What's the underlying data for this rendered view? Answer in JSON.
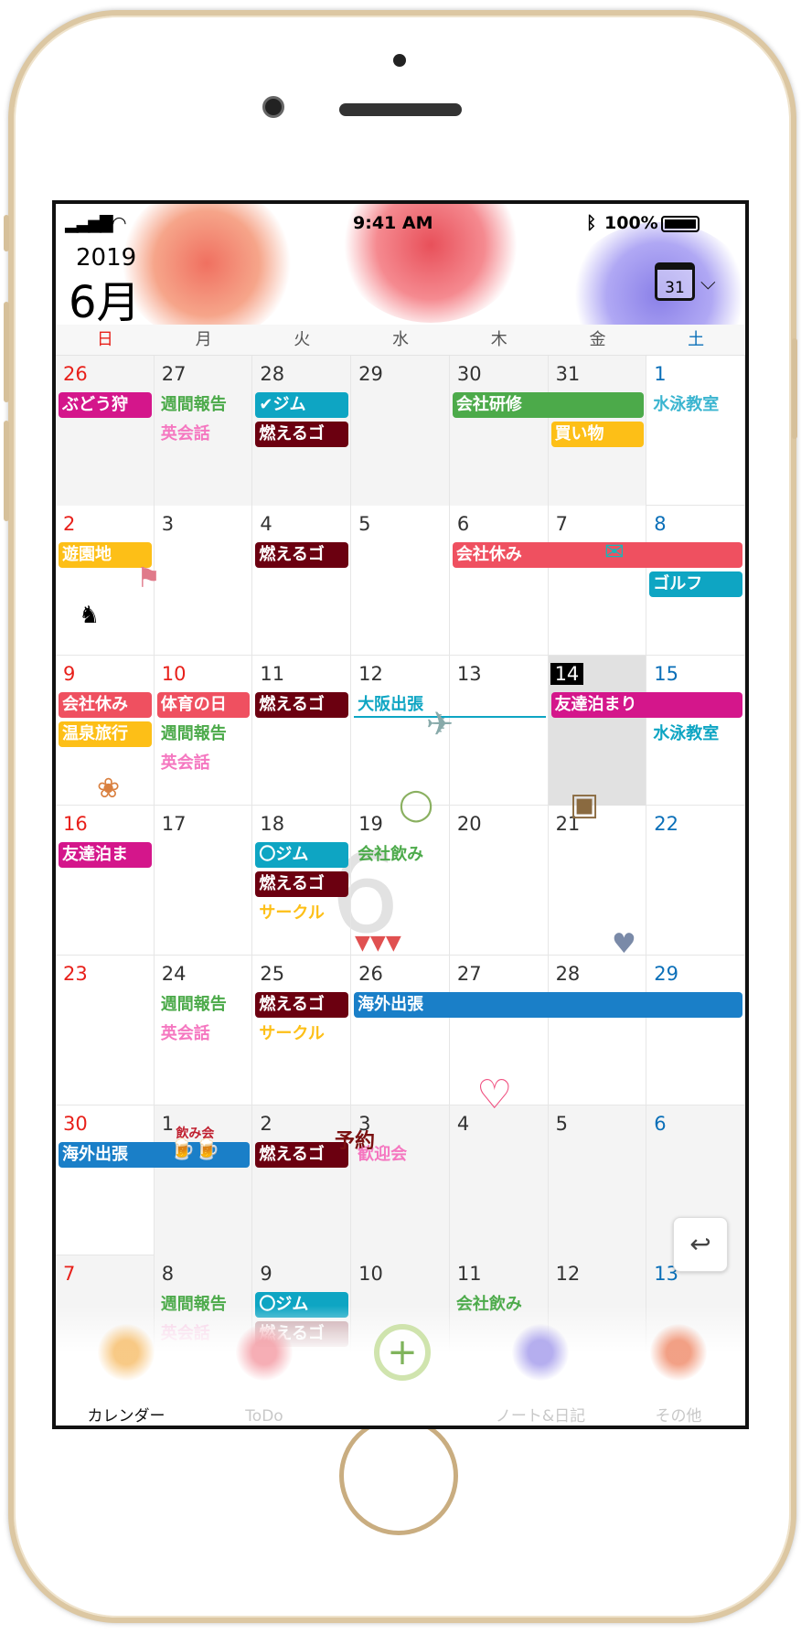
{
  "status": {
    "time": "9:41 AM",
    "battery": "100%",
    "signal_icon": "signal-icon",
    "wifi_icon": "wifi-icon",
    "bluetooth_icon": "bluetooth-icon"
  },
  "header": {
    "year": "2019",
    "month": "6月",
    "calendar_button": "31",
    "chevron": "⌵"
  },
  "weekdays": [
    "日",
    "月",
    "火",
    "水",
    "木",
    "金",
    "土"
  ],
  "watermark": "6",
  "colors": {
    "magenta": "#d4168b",
    "green": "#4caa4a",
    "pink": "#f577c0",
    "teal": "#0ea5c3",
    "maroon": "#6b0010",
    "yellow": "#fdbf17",
    "red": "#ef5060",
    "blue": "#1a7fc8",
    "sky": "#3bb5d0"
  },
  "weeks": [
    {
      "days": [
        {
          "d": "26",
          "other": true
        },
        {
          "d": "27",
          "other": true
        },
        {
          "d": "28",
          "other": true
        },
        {
          "d": "29",
          "other": true
        },
        {
          "d": "30",
          "other": true
        },
        {
          "d": "31",
          "other": true
        },
        {
          "d": "1"
        }
      ],
      "events": [
        {
          "text": "ぶどう狩",
          "col": 0,
          "span": 1,
          "lane": 0,
          "style": "bar",
          "color": "magenta"
        },
        {
          "text": "週間報告",
          "col": 1,
          "span": 1,
          "lane": 0,
          "style": "text",
          "color": "green"
        },
        {
          "text": "英会話",
          "col": 1,
          "span": 1,
          "lane": 1,
          "style": "text",
          "color": "pink"
        },
        {
          "text": "✔ジム",
          "col": 2,
          "span": 1,
          "lane": 0,
          "style": "bar",
          "color": "teal"
        },
        {
          "text": "燃えるゴ",
          "col": 2,
          "span": 1,
          "lane": 1,
          "style": "bar",
          "color": "maroon"
        },
        {
          "text": "会社研修",
          "col": 4,
          "span": 2,
          "lane": 0,
          "style": "bar",
          "color": "green"
        },
        {
          "text": "買い物",
          "col": 5,
          "span": 1,
          "lane": 1,
          "style": "bar",
          "color": "yellow"
        },
        {
          "text": "水泳教室",
          "col": 6,
          "span": 1,
          "lane": 0,
          "style": "text",
          "color": "sky"
        }
      ]
    },
    {
      "days": [
        {
          "d": "2"
        },
        {
          "d": "3"
        },
        {
          "d": "4"
        },
        {
          "d": "5"
        },
        {
          "d": "6"
        },
        {
          "d": "7"
        },
        {
          "d": "8"
        }
      ],
      "events": [
        {
          "text": "遊園地",
          "col": 0,
          "span": 1,
          "lane": 0,
          "style": "bar",
          "color": "yellow"
        },
        {
          "text": "燃えるゴ",
          "col": 2,
          "span": 1,
          "lane": 0,
          "style": "bar",
          "color": "maroon"
        },
        {
          "text": "会社休み",
          "col": 4,
          "span": 3,
          "lane": 0,
          "style": "bar",
          "color": "red"
        },
        {
          "text": "ゴルフ",
          "col": 6,
          "span": 1,
          "lane": 1,
          "style": "bar",
          "color": "teal"
        }
      ]
    },
    {
      "days": [
        {
          "d": "9"
        },
        {
          "d": "10",
          "holiday": true
        },
        {
          "d": "11"
        },
        {
          "d": "12"
        },
        {
          "d": "13"
        },
        {
          "d": "14",
          "today": true
        },
        {
          "d": "15"
        }
      ],
      "events": [
        {
          "text": "会社休み",
          "col": 0,
          "span": 1,
          "lane": 0,
          "style": "bar",
          "color": "red"
        },
        {
          "text": "温泉旅行",
          "col": 0,
          "span": 1,
          "lane": 1,
          "style": "bar",
          "color": "yellow"
        },
        {
          "text": "体育の日",
          "col": 1,
          "span": 1,
          "lane": 0,
          "style": "bar",
          "color": "red"
        },
        {
          "text": "週間報告",
          "col": 1,
          "span": 1,
          "lane": 1,
          "style": "text",
          "color": "green"
        },
        {
          "text": "英会話",
          "col": 1,
          "span": 1,
          "lane": 2,
          "style": "text",
          "color": "pink"
        },
        {
          "text": "燃えるゴ",
          "col": 2,
          "span": 1,
          "lane": 0,
          "style": "bar",
          "color": "maroon"
        },
        {
          "text": "大阪出張",
          "col": 3,
          "span": 2,
          "lane": 0,
          "style": "line",
          "color": "teal"
        },
        {
          "text": "友達泊まり",
          "col": 5,
          "span": 2,
          "lane": 0,
          "style": "bar",
          "color": "magenta"
        },
        {
          "text": "水泳教室",
          "col": 6,
          "span": 1,
          "lane": 1,
          "style": "text",
          "color": "teal"
        }
      ]
    },
    {
      "days": [
        {
          "d": "16"
        },
        {
          "d": "17"
        },
        {
          "d": "18"
        },
        {
          "d": "19"
        },
        {
          "d": "20"
        },
        {
          "d": "21"
        },
        {
          "d": "22"
        }
      ],
      "events": [
        {
          "text": "友達泊ま",
          "col": 0,
          "span": 1,
          "lane": 0,
          "style": "bar",
          "color": "magenta"
        },
        {
          "text": "〇ジム",
          "col": 2,
          "span": 1,
          "lane": 0,
          "style": "bar",
          "color": "teal"
        },
        {
          "text": "燃えるゴ",
          "col": 2,
          "span": 1,
          "lane": 1,
          "style": "bar",
          "color": "maroon"
        },
        {
          "text": "サークル",
          "col": 2,
          "span": 1,
          "lane": 2,
          "style": "text",
          "color": "yellow"
        },
        {
          "text": "会社飲み",
          "col": 3,
          "span": 1,
          "lane": 0,
          "style": "text",
          "color": "green"
        }
      ]
    },
    {
      "days": [
        {
          "d": "23"
        },
        {
          "d": "24"
        },
        {
          "d": "25"
        },
        {
          "d": "26"
        },
        {
          "d": "27"
        },
        {
          "d": "28"
        },
        {
          "d": "29"
        }
      ],
      "events": [
        {
          "text": "週間報告",
          "col": 1,
          "span": 1,
          "lane": 0,
          "style": "text",
          "color": "green"
        },
        {
          "text": "英会話",
          "col": 1,
          "span": 1,
          "lane": 1,
          "style": "text",
          "color": "pink"
        },
        {
          "text": "燃えるゴ",
          "col": 2,
          "span": 1,
          "lane": 0,
          "style": "bar",
          "color": "maroon"
        },
        {
          "text": "サークル",
          "col": 2,
          "span": 1,
          "lane": 1,
          "style": "text",
          "color": "yellow"
        },
        {
          "text": "海外出張",
          "col": 3,
          "span": 4,
          "lane": 0,
          "style": "bar",
          "color": "blue"
        }
      ]
    },
    {
      "days": [
        {
          "d": "30"
        },
        {
          "d": "1",
          "other": true
        },
        {
          "d": "2",
          "other": true
        },
        {
          "d": "3",
          "other": true
        },
        {
          "d": "4",
          "other": true
        },
        {
          "d": "5",
          "other": true
        },
        {
          "d": "6",
          "other": true
        }
      ],
      "events": [
        {
          "text": "海外出張",
          "col": 0,
          "span": 2,
          "lane": 0,
          "style": "bar",
          "color": "blue"
        },
        {
          "text": "燃えるゴ",
          "col": 2,
          "span": 1,
          "lane": 0,
          "style": "bar",
          "color": "maroon"
        },
        {
          "text": "歓迎会",
          "col": 3,
          "span": 1,
          "lane": 0,
          "style": "text",
          "color": "pink"
        }
      ]
    },
    {
      "days": [
        {
          "d": "7",
          "other": true
        },
        {
          "d": "8",
          "other": true
        },
        {
          "d": "9",
          "other": true
        },
        {
          "d": "10",
          "other": true
        },
        {
          "d": "11",
          "other": true
        },
        {
          "d": "12",
          "other": true
        },
        {
          "d": "13",
          "other": true
        }
      ],
      "events": [
        {
          "text": "週間報告",
          "col": 1,
          "span": 1,
          "lane": 0,
          "style": "text",
          "color": "green"
        },
        {
          "text": "英会話",
          "col": 1,
          "span": 1,
          "lane": 1,
          "style": "text",
          "color": "pink"
        },
        {
          "text": "〇ジム",
          "col": 2,
          "span": 1,
          "lane": 0,
          "style": "bar",
          "color": "teal"
        },
        {
          "text": "燃えるゴ",
          "col": 2,
          "span": 1,
          "lane": 1,
          "style": "bar",
          "color": "maroon"
        },
        {
          "text": "会社飲み",
          "col": 4,
          "span": 1,
          "lane": 0,
          "style": "text",
          "color": "green"
        }
      ]
    }
  ],
  "stickers": {
    "nomikai": "飲み会",
    "yoyaku": "予約"
  },
  "tabs": [
    {
      "label": "カレンダー",
      "active": true
    },
    {
      "label": "ToDo"
    },
    {
      "label": ""
    },
    {
      "label": "ノート&日記"
    },
    {
      "label": "その他"
    }
  ],
  "undo_icon": "↩"
}
